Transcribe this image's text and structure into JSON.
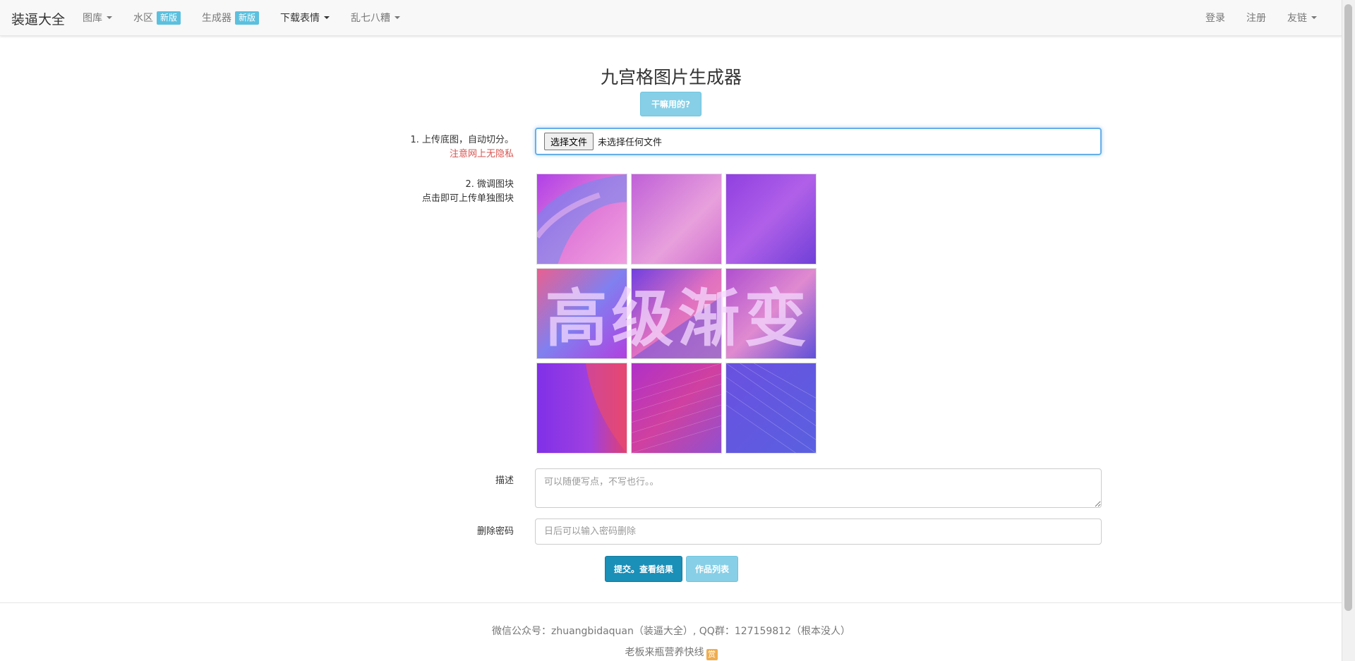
{
  "navbar": {
    "brand": "装逼大全",
    "left_items": [
      {
        "label": "图库",
        "caret": true
      },
      {
        "label": "水区",
        "badge": "新版"
      },
      {
        "label": "生成器",
        "badge": "新版"
      },
      {
        "label": "下载表情",
        "caret": true,
        "active": true
      },
      {
        "label": "乱七八糟",
        "caret": true
      }
    ],
    "right_items": [
      {
        "label": "登录"
      },
      {
        "label": "注册"
      },
      {
        "label": "友链",
        "caret": true
      }
    ]
  },
  "main": {
    "title": "九宫格图片生成器",
    "help_button": "干嘛用的?",
    "upload": {
      "label": "1. 上传底图，自动切分。",
      "warning": "注意网上无隐私",
      "choose_button": "选择文件",
      "status": "未选择任何文件"
    },
    "tiles": {
      "label": "2. 微调图块",
      "sublabel": "点击即可上传单独图块",
      "watermark": "高级渐变"
    },
    "description": {
      "label": "描述",
      "placeholder": "可以随便写点，不写也行。。"
    },
    "password": {
      "label": "删除密码",
      "placeholder": "日后可以输入密码删除"
    },
    "submit_button": "提交。查看结果",
    "list_button": "作品列表"
  },
  "footer": {
    "contact": "微信公众号：zhuangbidaquan（装逼大全）, QQ群：127159812（根本没人）",
    "donate": "老板来瓶营养快线",
    "donate_icon": "coffee-icon",
    "donate_glyph": "赏"
  },
  "colors": {
    "accent": "#5bc0de",
    "primary": "#1a8fb8",
    "danger": "#d9534f",
    "focus": "#66afe9"
  }
}
